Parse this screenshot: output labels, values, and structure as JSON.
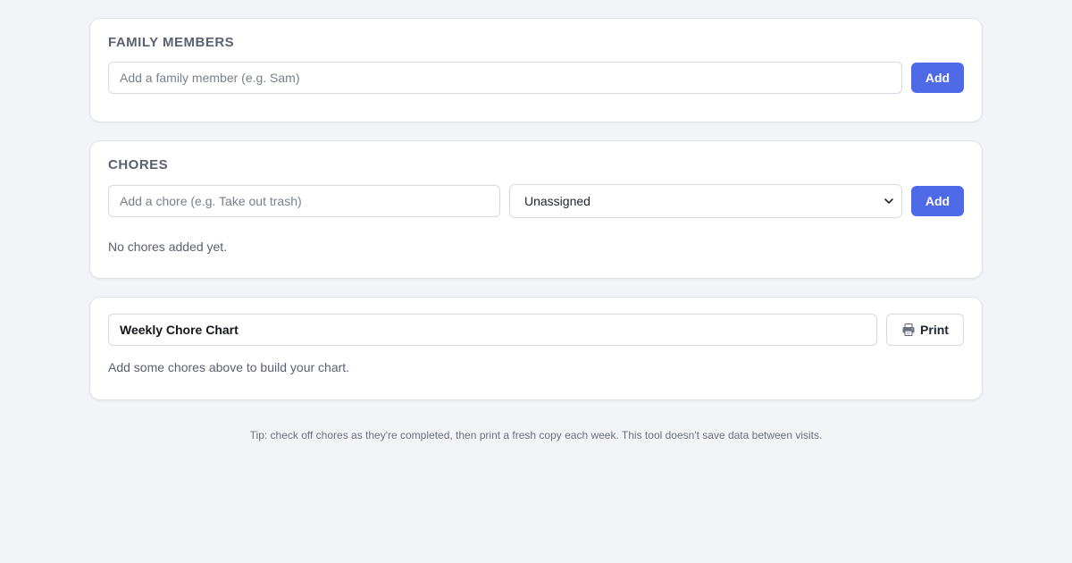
{
  "members": {
    "title": "FAMILY MEMBERS",
    "input_placeholder": "Add a family member (e.g. Sam)",
    "input_value": "",
    "add_label": "Add"
  },
  "chores": {
    "title": "CHORES",
    "input_placeholder": "Add a chore (e.g. Take out trash)",
    "input_value": "",
    "assignee_selected": "Unassigned",
    "add_label": "Add",
    "empty_message": "No chores added yet."
  },
  "chart": {
    "title_value": "Weekly Chore Chart",
    "print_label": "Print",
    "empty_message": "Add some chores above to build your chart."
  },
  "footer": {
    "tip": "Tip: check off chores as they're completed, then print a fresh copy each week. This tool doesn't save data between visits."
  },
  "icons": {
    "print": "printer-icon",
    "select": "chevron-down-icon"
  },
  "colors": {
    "accent": "#4f6ae6",
    "background": "#f3f4f8",
    "card": "#ffffff",
    "muted_text": "#5b6070"
  }
}
